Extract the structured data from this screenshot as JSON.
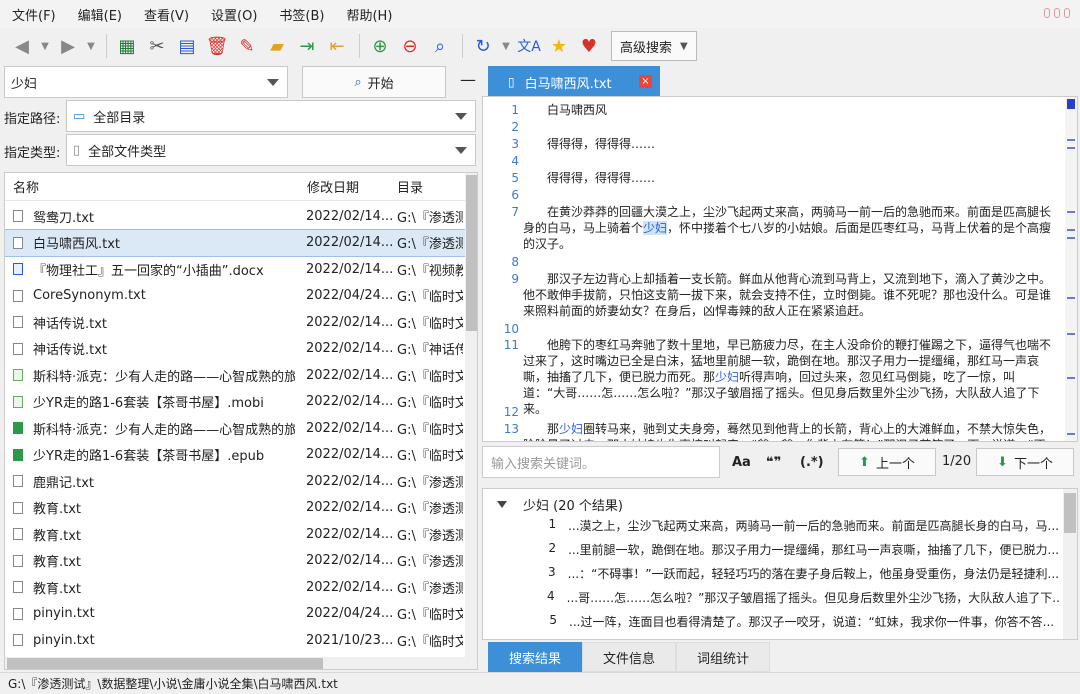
{
  "menu": [
    "文件(F)",
    "编辑(E)",
    "查看(V)",
    "设置(O)",
    "书签(B)",
    "帮助(H)"
  ],
  "toolbar": {
    "icons": [
      "back-icon",
      "forward-icon",
      "excel-icon",
      "cut-icon",
      "document-icon",
      "delete-icon",
      "magic-icon",
      "folder-icon",
      "export-icon",
      "import-icon",
      "zoom-in-icon",
      "zoom-out-icon",
      "search-icon",
      "refresh-icon",
      "translate-icon",
      "star-icon",
      "heart-icon"
    ],
    "advanced_search": "高级搜索"
  },
  "search": {
    "query": "少妇",
    "start_label": "开始",
    "minimize": "—"
  },
  "path": {
    "label": "指定路径:",
    "value": "全部目录"
  },
  "type": {
    "label": "指定类型:",
    "value": "全部文件类型"
  },
  "filelist": {
    "columns": [
      "名称",
      "修改日期",
      "目录"
    ],
    "rows": [
      {
        "name": "鸳鸯刀.txt",
        "date": "2022/02/14...",
        "dir": "G:\\『渗透测...",
        "icon": "txt"
      },
      {
        "name": "白马啸西风.txt",
        "date": "2022/02/14...",
        "dir": "G:\\『渗透测...",
        "icon": "txt",
        "selected": true
      },
      {
        "name": "『物理社工』五一回家的“小插曲”.docx",
        "date": "2022/02/14...",
        "dir": "G:\\『视频教...",
        "icon": "doc"
      },
      {
        "name": "CoreSynonym.txt",
        "date": "2022/04/24...",
        "dir": "G:\\『临时文...",
        "icon": "txt"
      },
      {
        "name": "神话传说.txt",
        "date": "2022/02/14...",
        "dir": "G:\\『临时文...",
        "icon": "txt"
      },
      {
        "name": "神话传说.txt",
        "date": "2022/02/14...",
        "dir": "G:\\『神话传...",
        "icon": "txt"
      },
      {
        "name": "斯科特·派克：少有人走的路——心智成熟的旅...",
        "date": "2022/02/14...",
        "dir": "G:\\『临时文...",
        "icon": "mobi"
      },
      {
        "name": "少YR走的路1-6套装【茶哥书屋】.mobi",
        "date": "2022/02/14...",
        "dir": "G:\\『临时文...",
        "icon": "mobi"
      },
      {
        "name": "斯科特·派克：少有人走的路——心智成熟的旅...",
        "date": "2022/02/14...",
        "dir": "G:\\『临时文...",
        "icon": "epub"
      },
      {
        "name": "少YR走的路1-6套装【茶哥书屋】.epub",
        "date": "2022/02/14...",
        "dir": "G:\\『临时文...",
        "icon": "epub"
      },
      {
        "name": "鹿鼎记.txt",
        "date": "2022/02/14...",
        "dir": "G:\\『渗透测...",
        "icon": "txt"
      },
      {
        "name": "教育.txt",
        "date": "2022/02/14...",
        "dir": "G:\\『渗透测...",
        "icon": "txt"
      },
      {
        "name": "教育.txt",
        "date": "2022/02/14...",
        "dir": "G:\\『渗透测...",
        "icon": "txt"
      },
      {
        "name": "教育.txt",
        "date": "2022/02/14...",
        "dir": "G:\\『渗透测...",
        "icon": "txt"
      },
      {
        "name": "教育.txt",
        "date": "2022/02/14...",
        "dir": "G:\\『渗透测...",
        "icon": "txt"
      },
      {
        "name": "pinyin.txt",
        "date": "2022/04/24...",
        "dir": "G:\\『临时文...",
        "icon": "txt"
      },
      {
        "name": "pinyin.txt",
        "date": "2021/10/23...",
        "dir": "G:\\『临时文...",
        "icon": "txt"
      }
    ]
  },
  "editor": {
    "tab_title": "白马啸西风.txt",
    "close": "×",
    "lines": [
      {
        "n": "1",
        "t": "白马啸西风"
      },
      {
        "n": "2",
        "t": ""
      },
      {
        "n": "3",
        "t": "得得得，得得得……"
      },
      {
        "n": "4",
        "t": ""
      },
      {
        "n": "5",
        "t": "得得得，得得得……"
      },
      {
        "n": "6",
        "t": ""
      },
      {
        "n": "7",
        "t": "在黄沙莽莽的回疆大漠之上，尘沙飞起两丈来高，两骑马一前一后的急驰而来。前面是匹高腿长身的白马，马上骑着个少妇，怀中搂着个七八岁的小姑娘。后面是匹枣红马，马背上伏着的是个高瘦的汉子。"
      },
      {
        "n": "8",
        "t": ""
      },
      {
        "n": "9",
        "t": "那汉子左边背心上却插着一支长箭。鲜血从他背心流到马背上，又流到地下，滴入了黄沙之中。他不敢伸手拔箭，只怕这支箭一拔下来，就会支持不住，立时倒毙。谁不死呢？那也没什么。可是谁来照料前面的娇妻幼女？在身后，凶悍毒辣的敌人正在紧紧追赶。"
      },
      {
        "n": "10",
        "t": ""
      },
      {
        "n": "11",
        "t": "他胯下的枣红马奔驰了数十里地，早已筋疲力尽，在主人没命价的鞭打催踢之下，逼得气也喘不过来了，这时嘴边已全是白沫，猛地里前腿一软，跪倒在地。那汉子用力一提缰绳，那红马一声哀嘶，抽搐了几下，便已脱力而死。那少妇听得声响，回过头来，忽见红马倒毙，吃了一惊，叫道：“大哥……怎……怎么啦？”那汉子皱眉摇了摇头。但见身后数里外尘沙飞扬，大队敌人追了下来。"
      },
      {
        "n": "12",
        "t": ""
      },
      {
        "n": "13",
        "t": "那少妇圈转马来，驰到丈夫身旁，蓦然见到他背上的长箭，背心上的大滩鲜血，不禁大惊失色，险险晕了过去。那小姑娘也失声惊叫起来：“爹，爹，你背上有箭！”那汉子苦笑了一下，说道：“不碍"
      }
    ]
  },
  "find": {
    "placeholder": "输入搜索关键词。",
    "opt_case": "Aa",
    "opt_quote": "❝❞",
    "opt_regex": "(.*)",
    "prev": "上一个",
    "count": "1/20",
    "next": "下一个"
  },
  "results": {
    "header": "少妇 (20 个结果)",
    "rows": [
      {
        "n": "1",
        "t": "...漠之上，尘沙飞起两丈来高，两骑马一前一后的急驰而来。前面是匹高腿长身的白马，马..."
      },
      {
        "n": "2",
        "t": "...里前腿一软，跪倒在地。那汉子用力一提缰绳，那红马一声哀嘶，抽搐了几下，便已脱力..."
      },
      {
        "n": "3",
        "t": "...：“不碍事！”一跃而起，轻轻巧巧的落在妻子身后鞍上，他虽身受重伤，身法仍是轻捷利..."
      },
      {
        "n": "4",
        "t": "...哥……怎……怎么啦？”那汉子皱眉摇了摇头。但见身后数里外尘沙飞扬，大队敌人追了下..."
      },
      {
        "n": "5",
        "t": "...过一阵，连面目也看得清楚了。那汉子一咬牙，说道：“虹妹，我求你一件事，你答不答..."
      }
    ]
  },
  "bottom_tabs": [
    "搜索结果",
    "文件信息",
    "词组统计"
  ],
  "status": "G:\\『渗透测试』\\数据整理\\小说\\金庸小说全集\\白马啸西风.txt"
}
